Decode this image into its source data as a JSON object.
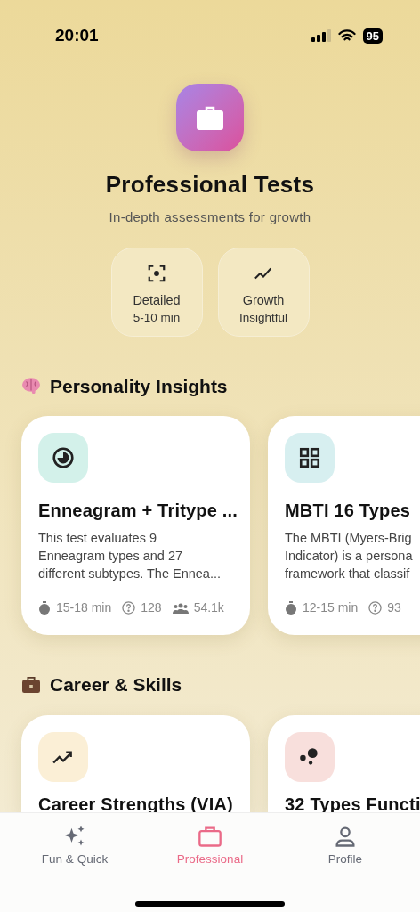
{
  "status_bar": {
    "time": "20:01",
    "battery": "95"
  },
  "header": {
    "title": "Professional Tests",
    "subtitle": "In-depth assessments for growth"
  },
  "chips": [
    {
      "kind": "focus",
      "label": "Detailed",
      "sub": "5-10 min"
    },
    {
      "kind": "growth",
      "label": "Growth",
      "sub": "Insightful"
    }
  ],
  "sections": [
    {
      "kind": "brain",
      "title": "Personality Insights",
      "cards": [
        {
          "kind": "pie",
          "color": "#d3f1ea",
          "title": "Enneagram + Tritype ...",
          "description": "This test evaluates 9\nEnneagram types and 27\ndifferent subtypes. The Ennea...",
          "duration": "15-18 min",
          "questions": "128",
          "takers": "54.1k"
        },
        {
          "kind": "grid",
          "color": "#d7eff0",
          "title": "MBTI 16 Types",
          "description": "The MBTI (Myers-Brig\nIndicator) is a persona\nframework that classif",
          "duration": "12-15 min",
          "questions": "93"
        }
      ]
    },
    {
      "kind": "briefcase",
      "title": "Career & Skills",
      "cards": [
        {
          "kind": "trend",
          "color": "#fbefd6",
          "title": "Career Strengths (VIA)"
        },
        {
          "kind": "dots",
          "color": "#f8dfdc",
          "title": "32 Types Functi"
        }
      ]
    }
  ],
  "tab_bar": [
    {
      "kind": "sparkles",
      "label": "Fun & Quick",
      "selected": false
    },
    {
      "kind": "briefcase",
      "label": "Professional",
      "selected": true
    },
    {
      "kind": "person",
      "label": "Profile",
      "selected": false
    }
  ]
}
